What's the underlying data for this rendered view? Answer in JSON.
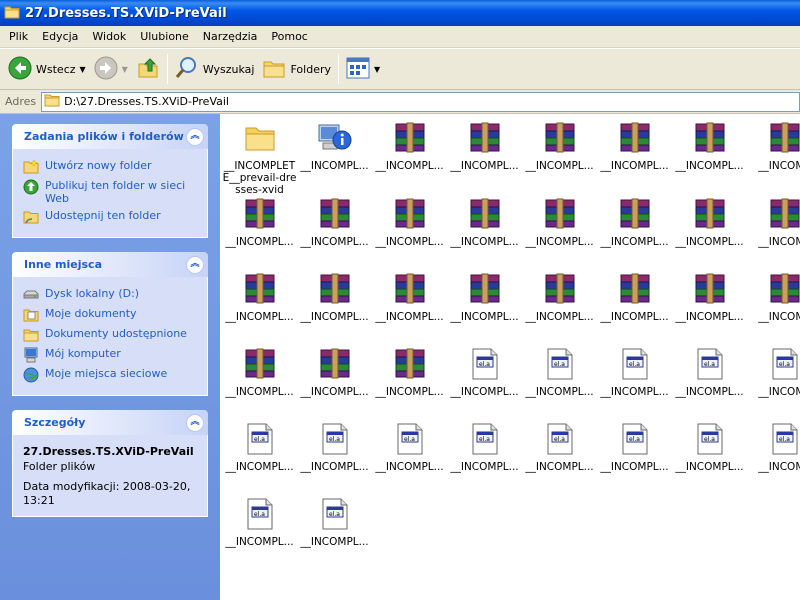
{
  "window": {
    "title": "27.Dresses.TS.XViD-PreVail"
  },
  "menu": [
    "Plik",
    "Edycja",
    "Widok",
    "Ulubione",
    "Narzędzia",
    "Pomoc"
  ],
  "toolbar": {
    "back": "Wstecz",
    "search": "Wyszukaj",
    "folders": "Foldery"
  },
  "address": {
    "label": "Adres",
    "path": "D:\\27.Dresses.TS.XViD-PreVail"
  },
  "tasks_panel": {
    "title": "Zadania plików i folderów",
    "items": [
      {
        "label": "Utwórz nowy folder",
        "icon": "new-folder-icon"
      },
      {
        "label": "Publikuj ten folder w sieci Web",
        "icon": "publish-web-icon"
      },
      {
        "label": "Udostępnij ten folder",
        "icon": "share-folder-icon"
      }
    ]
  },
  "places_panel": {
    "title": "Inne miejsca",
    "items": [
      {
        "label": "Dysk lokalny (D:)",
        "icon": "drive-icon"
      },
      {
        "label": "Moje dokumenty",
        "icon": "my-documents-icon"
      },
      {
        "label": "Dokumenty udostępnione",
        "icon": "shared-documents-icon"
      },
      {
        "label": "Mój komputer",
        "icon": "my-computer-icon"
      },
      {
        "label": "Moje miejsca sieciowe",
        "icon": "network-places-icon"
      }
    ]
  },
  "details_panel": {
    "title": "Szczegóły",
    "name": "27.Dresses.TS.XViD-PreVail",
    "type": "Folder plików",
    "modified": "Data modyfikacji: 2008-03-20, 13:21"
  },
  "files": [
    {
      "name": "__INCOMPLETE__prevail-dresses-xvid",
      "icon": "folder"
    },
    {
      "name": "__INCOMPL...",
      "icon": "info"
    },
    {
      "name": "__INCOMPL...",
      "icon": "rar"
    },
    {
      "name": "__INCOMPL...",
      "icon": "rar"
    },
    {
      "name": "__INCOMPL...",
      "icon": "rar"
    },
    {
      "name": "__INCOMPL...",
      "icon": "rar"
    },
    {
      "name": "__INCOMPL...",
      "icon": "rar"
    },
    {
      "name": "__INCOMP",
      "icon": "rar"
    },
    {
      "name": "__INCOMPL...",
      "icon": "rar"
    },
    {
      "name": "__INCOMPL...",
      "icon": "rar"
    },
    {
      "name": "__INCOMPL...",
      "icon": "rar"
    },
    {
      "name": "__INCOMPL...",
      "icon": "rar"
    },
    {
      "name": "__INCOMPL...",
      "icon": "rar"
    },
    {
      "name": "__INCOMPL...",
      "icon": "rar"
    },
    {
      "name": "__INCOMPL...",
      "icon": "rar"
    },
    {
      "name": "__INCOMP",
      "icon": "rar"
    },
    {
      "name": "__INCOMPL...",
      "icon": "rar"
    },
    {
      "name": "__INCOMPL...",
      "icon": "rar"
    },
    {
      "name": "__INCOMPL...",
      "icon": "rar"
    },
    {
      "name": "__INCOMPL...",
      "icon": "rar"
    },
    {
      "name": "__INCOMPL...",
      "icon": "rar"
    },
    {
      "name": "__INCOMPL...",
      "icon": "rar"
    },
    {
      "name": "__INCOMPL...",
      "icon": "rar"
    },
    {
      "name": "__INCOMP",
      "icon": "rar"
    },
    {
      "name": "__INCOMPL...",
      "icon": "rar"
    },
    {
      "name": "__INCOMPL...",
      "icon": "rar"
    },
    {
      "name": "__INCOMPL...",
      "icon": "rar"
    },
    {
      "name": "__INCOMPL...",
      "icon": "doc"
    },
    {
      "name": "__INCOMPL...",
      "icon": "doc"
    },
    {
      "name": "__INCOMPL...",
      "icon": "doc"
    },
    {
      "name": "__INCOMPL...",
      "icon": "doc"
    },
    {
      "name": "__INCOMP",
      "icon": "doc"
    },
    {
      "name": "__INCOMPL...",
      "icon": "doc"
    },
    {
      "name": "__INCOMPL...",
      "icon": "doc"
    },
    {
      "name": "__INCOMPL...",
      "icon": "doc"
    },
    {
      "name": "__INCOMPL...",
      "icon": "doc"
    },
    {
      "name": "__INCOMPL...",
      "icon": "doc"
    },
    {
      "name": "__INCOMPL...",
      "icon": "doc"
    },
    {
      "name": "__INCOMPL...",
      "icon": "doc"
    },
    {
      "name": "__INCOMP",
      "icon": "doc"
    },
    {
      "name": "__INCOMPL...",
      "icon": "doc"
    },
    {
      "name": "__INCOMPL...",
      "icon": "doc"
    }
  ]
}
